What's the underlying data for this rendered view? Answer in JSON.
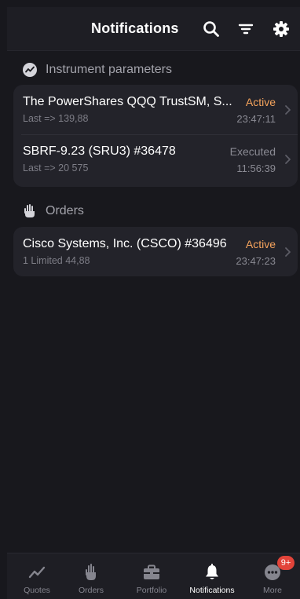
{
  "header": {
    "title": "Notifications",
    "search_icon": "search-icon",
    "filter_icon": "filter-icon",
    "settings_icon": "gear-icon"
  },
  "sections": [
    {
      "label": "Instrument parameters",
      "icon": "trend-chart-icon",
      "items": [
        {
          "title": "The PowerShares QQQ TrustSM, S...",
          "subtitle": "Last => 139,88",
          "status": "Active",
          "time": "23:47:11"
        },
        {
          "title": "SBRF-9.23 (SRU3) #36478",
          "subtitle": "Last => 20 575",
          "status": "Executed",
          "time": "11:56:39"
        }
      ]
    },
    {
      "label": "Orders",
      "icon": "hand-icon",
      "items": [
        {
          "title": "Cisco Systems, Inc. (CSCO) #36496",
          "subtitle": "1 Limited 44,88",
          "status": "Active",
          "time": "23:47:23"
        }
      ]
    }
  ],
  "tabbar": {
    "tabs": [
      {
        "label": "Quotes",
        "icon": "trend-line-icon"
      },
      {
        "label": "Orders",
        "icon": "hand-icon"
      },
      {
        "label": "Portfolio",
        "icon": "briefcase-icon"
      },
      {
        "label": "Notifications",
        "icon": "bell-icon",
        "active": true
      },
      {
        "label": "More",
        "icon": "more-dots-icon",
        "badge": "9+"
      }
    ]
  },
  "colors": {
    "background": "#18181d",
    "card": "#23232a",
    "active_status": "#f5a35c",
    "badge": "#e2443a"
  }
}
